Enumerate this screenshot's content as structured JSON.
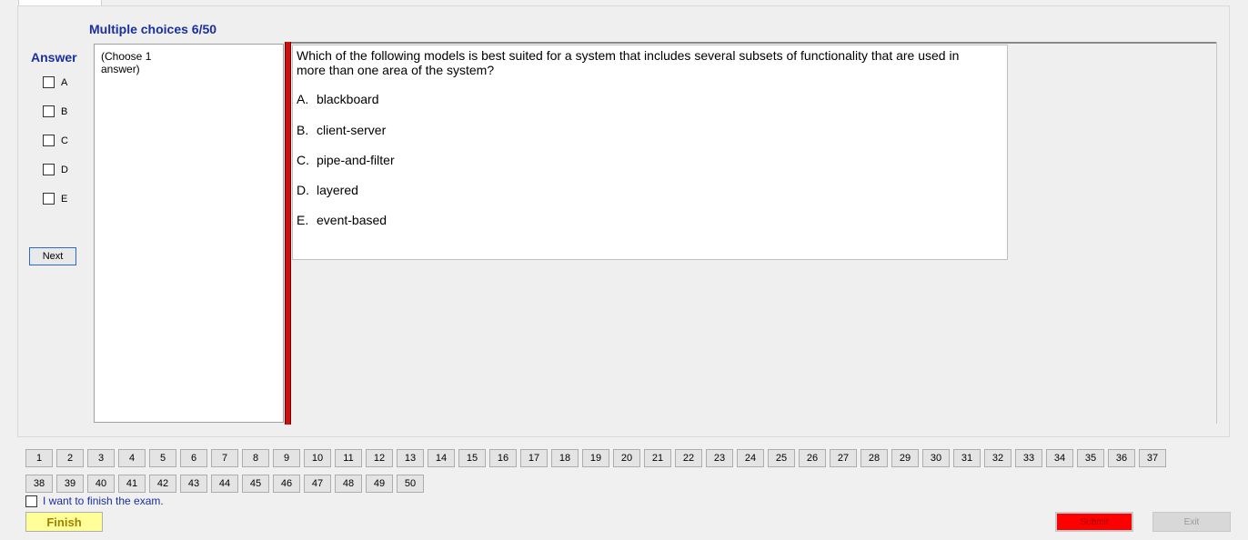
{
  "header": {
    "title": "Multiple choices 6/50"
  },
  "answer_panel": {
    "label": "Answer",
    "options": [
      "A",
      "B",
      "C",
      "D",
      "E"
    ],
    "next_label": "Next"
  },
  "instruction": {
    "line1": "(Choose 1",
    "line2": "answer)"
  },
  "question": {
    "text": "Which of the following models is best suited for a system that includes several subsets of functionality that are used in more than one area of the system?",
    "options": [
      {
        "letter": "A.",
        "text": "blackboard"
      },
      {
        "letter": "B.",
        "text": "client-server"
      },
      {
        "letter": "C.",
        "text": "pipe-and-filter"
      },
      {
        "letter": "D.",
        "text": "layered"
      },
      {
        "letter": "E.",
        "text": "event-based"
      }
    ]
  },
  "navigation": {
    "row1": [
      "1",
      "2",
      "3",
      "4",
      "5",
      "6",
      "7",
      "8",
      "9",
      "10",
      "11",
      "12",
      "13",
      "14",
      "15",
      "16",
      "17",
      "18",
      "19",
      "20",
      "21",
      "22",
      "23",
      "24",
      "25",
      "26",
      "27",
      "28",
      "29",
      "30",
      "31",
      "32",
      "33",
      "34",
      "35",
      "36",
      "37"
    ],
    "row2": [
      "38",
      "39",
      "40",
      "41",
      "42",
      "43",
      "44",
      "45",
      "46",
      "47",
      "48",
      "49",
      "50"
    ]
  },
  "footer": {
    "finish_checkbox_label": "I want to finish the exam.",
    "finish_label": "Finish",
    "submit_label": "Submit",
    "exit_label": "Exit"
  },
  "colors": {
    "title_blue": "#1a2fa0",
    "red_bar": "#cc1111",
    "finish_yellow": "#ffff99",
    "submit_red": "#ff0000"
  }
}
